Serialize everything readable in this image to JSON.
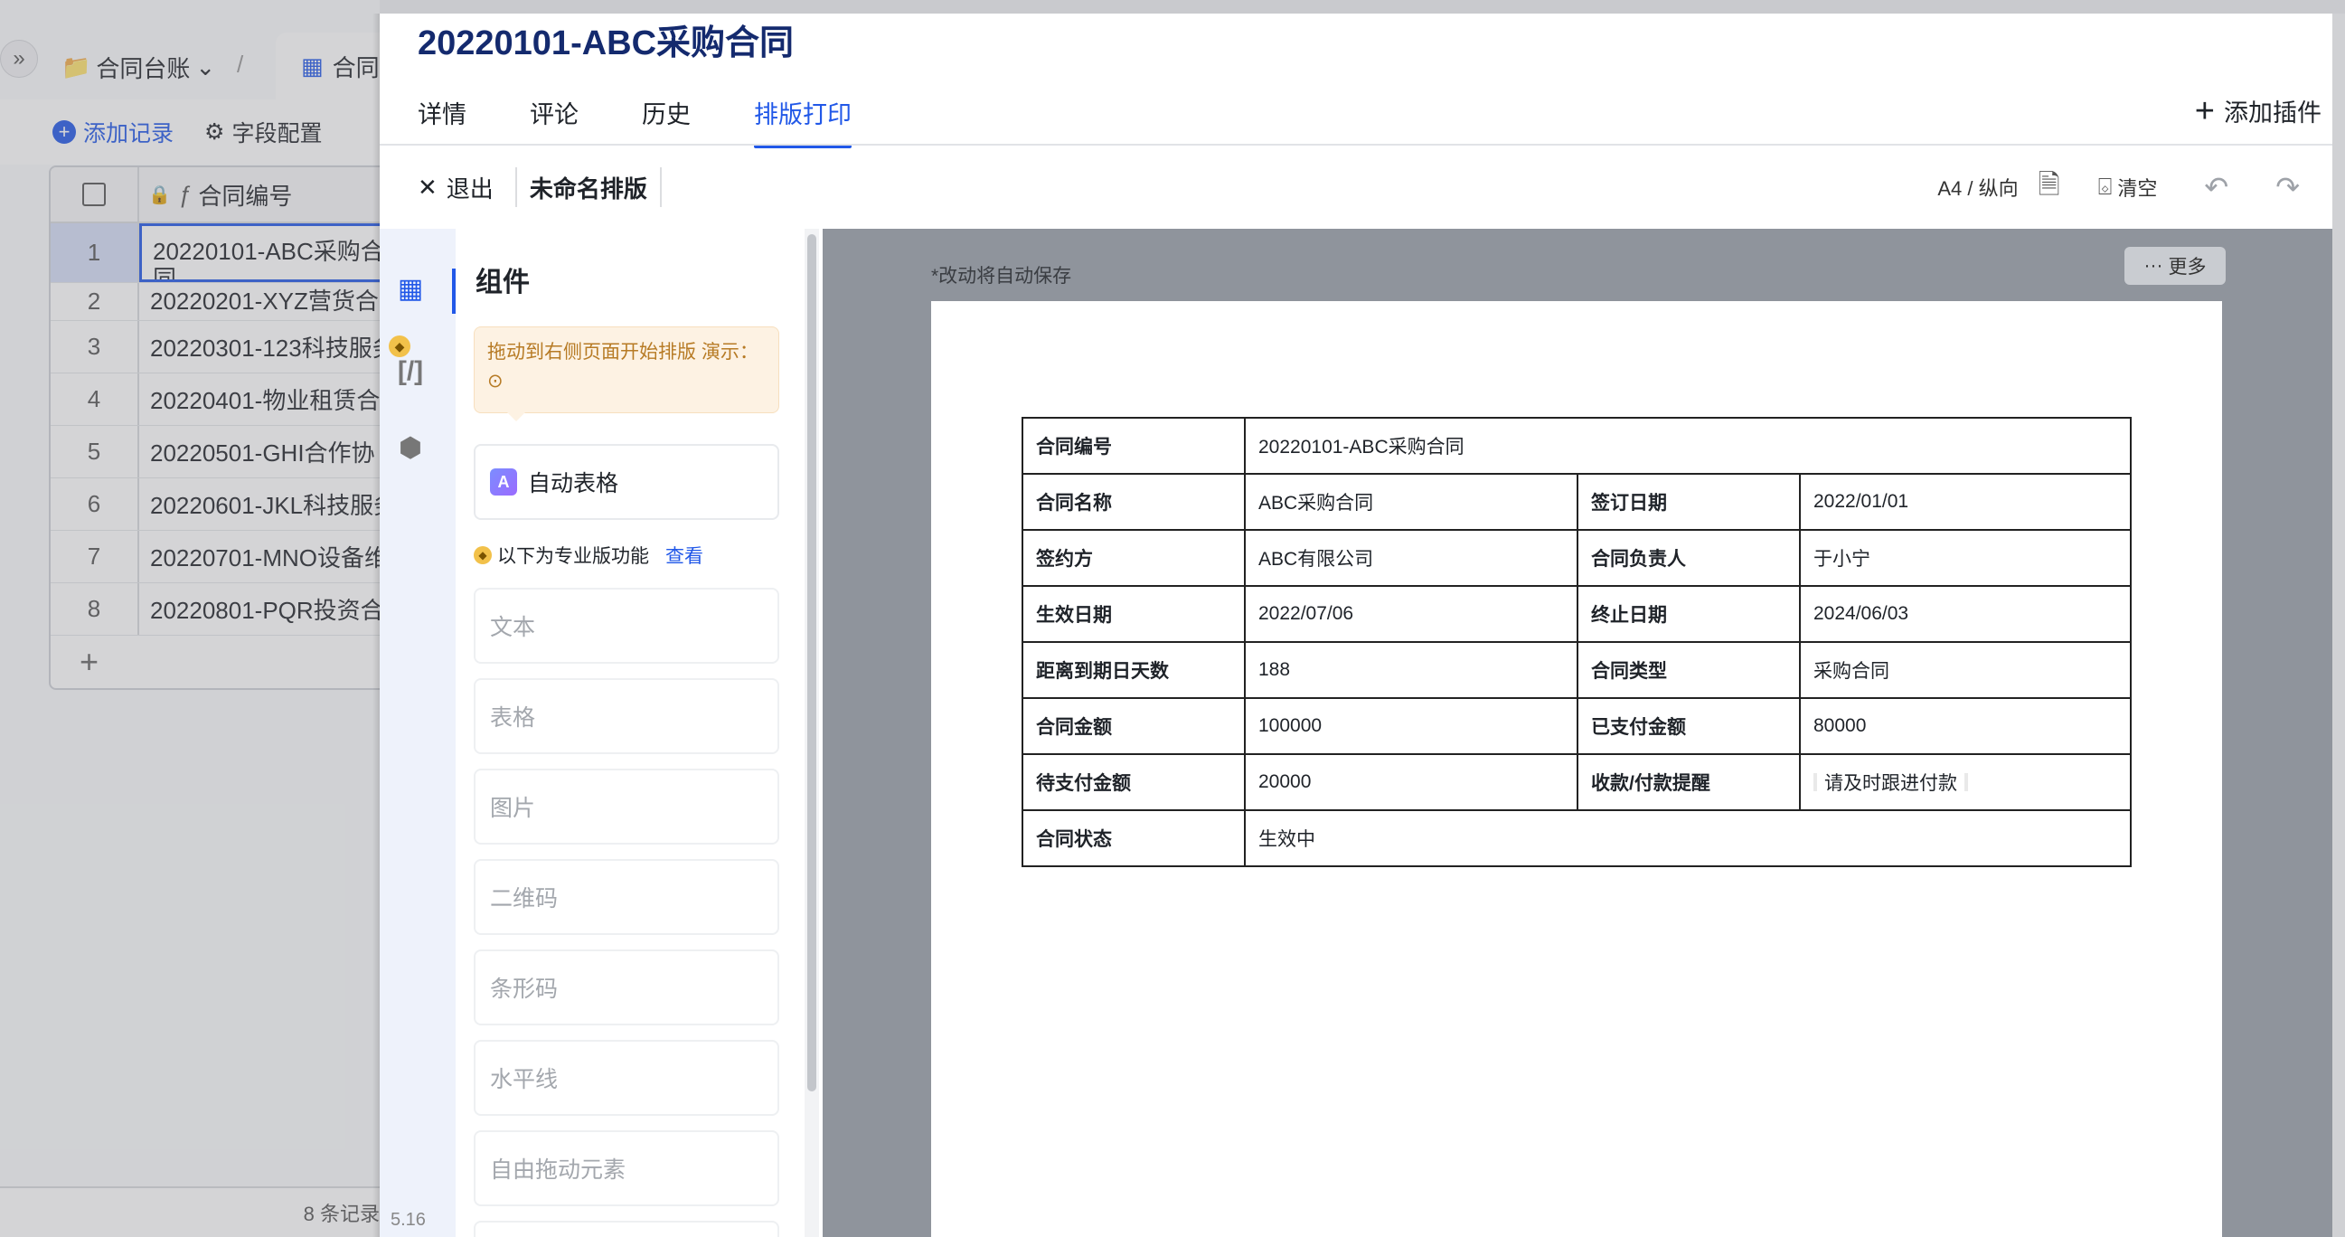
{
  "background": {
    "breadcrumb_folder": "合同台账",
    "tab_label": "合同",
    "toolbar": {
      "add_record": "添加记录",
      "field_config": "字段配置"
    },
    "grid": {
      "column_header": "合同编号",
      "rows": [
        {
          "n": "1",
          "v": "20220101-ABC采购合同"
        },
        {
          "n": "2",
          "v": "20220201-XYZ营货合"
        },
        {
          "n": "3",
          "v": "20220301-123科技服务"
        },
        {
          "n": "4",
          "v": "20220401-物业租赁合"
        },
        {
          "n": "5",
          "v": "20220501-GHI合作协"
        },
        {
          "n": "6",
          "v": "20220601-JKL科技服务"
        },
        {
          "n": "7",
          "v": "20220701-MNO设备维"
        },
        {
          "n": "8",
          "v": "20220801-PQR投资合"
        }
      ],
      "add": "+"
    },
    "status": "8 条记录"
  },
  "modal": {
    "title": "20220101-ABC采购合同",
    "tabs": [
      {
        "label": "详情"
      },
      {
        "label": "评论"
      },
      {
        "label": "历史"
      },
      {
        "label": "排版打印"
      }
    ],
    "add_plugin": "添加插件",
    "toolbar": {
      "exit": "退出",
      "layout_name": "未命名排版",
      "paper_size": "A4 / 纵向",
      "clear": "清空"
    },
    "rail": {
      "version": "5.16"
    },
    "components": {
      "title": "组件",
      "tip": "拖动到右侧页面开始排版 演示：",
      "auto_table": "自动表格",
      "pro_notice": "以下为专业版功能",
      "pro_link": "查看",
      "items": [
        "文本",
        "表格",
        "图片",
        "二维码",
        "条形码",
        "水平线",
        "自由拖动元素"
      ]
    },
    "canvas": {
      "autosave": "*改动将自动保存",
      "more": "更多",
      "table": [
        [
          "合同编号",
          "20220101-ABC采购合同"
        ],
        [
          "合同名称",
          "ABC采购合同",
          "签订日期",
          "2022/01/01"
        ],
        [
          "签约方",
          "ABC有限公司",
          "合同负责人",
          "于小宁"
        ],
        [
          "生效日期",
          "2022/07/06",
          "终止日期",
          "2024/06/03"
        ],
        [
          "距离到期日天数",
          "188",
          "合同类型",
          "采购合同"
        ],
        [
          "合同金额",
          "100000",
          "已支付金额",
          "80000"
        ],
        [
          "待支付金额",
          "20000",
          "收款/付款提醒",
          "请及时跟进付款"
        ],
        [
          "合同状态",
          "生效中"
        ]
      ]
    }
  },
  "colors": {
    "accent": "#2158e8",
    "title": "#142a6e",
    "tip_bg": "#fdf2e3",
    "tip_text": "#b77b25"
  }
}
